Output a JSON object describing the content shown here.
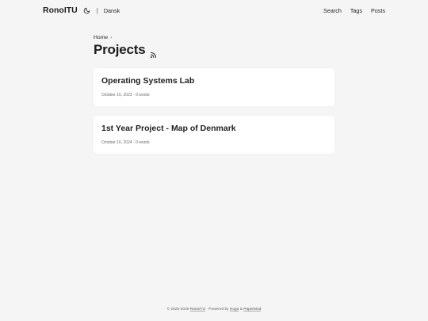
{
  "header": {
    "logo": "RonoITU",
    "separator": "|",
    "language": "Dansk",
    "nav": [
      "Search",
      "Tags",
      "Posts"
    ]
  },
  "breadcrumb": {
    "home": "Home",
    "chevron": "›"
  },
  "page": {
    "title": "Projects"
  },
  "posts": [
    {
      "title": "Operating Systems Lab",
      "meta": "October 16, 2023 · 0 words"
    },
    {
      "title": "1st Year Project - Map of Denmark",
      "meta": "October 16, 2024 · 0 words"
    }
  ],
  "footer": {
    "copyright": "© 2025-2026 ",
    "site": "RonoITU",
    "powered_by": " · Powered by ",
    "hugo": "Hugo",
    "amp": " & ",
    "theme": "PaperMod"
  }
}
